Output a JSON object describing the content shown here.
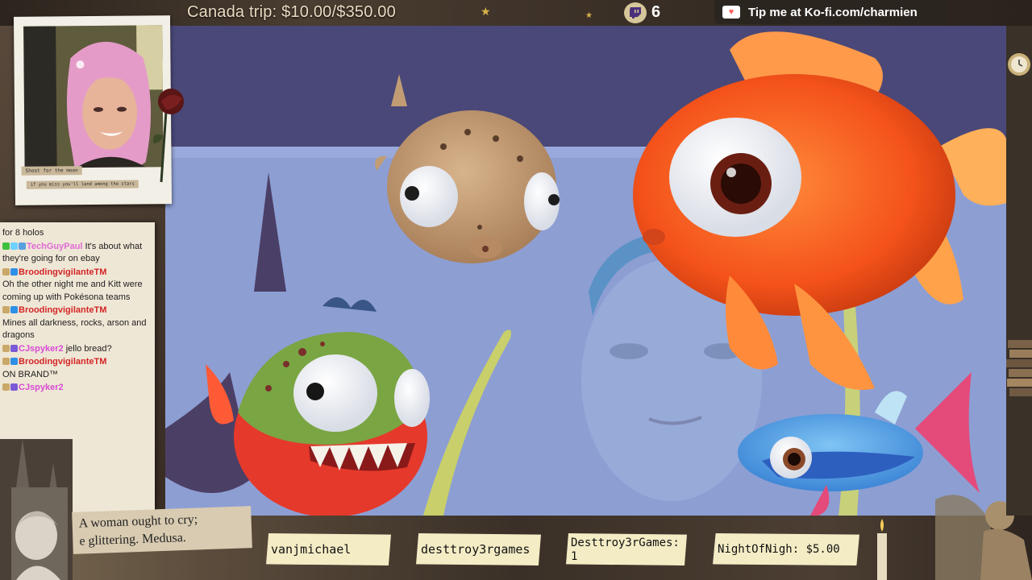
{
  "stream": {
    "goal_text": "Canada trip: $10.00/$350.00",
    "viewer_count": "6",
    "tip_text": "Tip me at Ko-fi.com/charmien"
  },
  "webcam": {
    "note_top": "Shoot for the moon",
    "note_bottom": "if you miss you'll land among the stars"
  },
  "chat": {
    "messages": [
      {
        "user": "",
        "text": "for 8 holos",
        "color": "#1e1e1e"
      },
      {
        "user": "TechGuyPaul",
        "text": " It's about what they're going for on ebay",
        "color": "#e06ad7"
      },
      {
        "user": "BroodingvigilanteTM",
        "text": "Oh the other night me and Kitt were coming up with Pokésona teams",
        "color": "#d42525"
      },
      {
        "user": "BroodingvigilanteTM",
        "text": "Mines all darkness, rocks, arson and dragons",
        "color": "#d42525"
      },
      {
        "user": "CJspyker2",
        "text": " jello bread?",
        "color": "#d94bd4"
      },
      {
        "user": "BroodingvigilanteTM",
        "text": "ON BRAND™",
        "color": "#d42525"
      },
      {
        "user": "CJspyker2",
        "text": "",
        "color": "#d94bd4"
      }
    ]
  },
  "collage": {
    "line1": "A woman ought to cry;",
    "line2": "e glittering. Medusa."
  },
  "labels": [
    {
      "text": "vanjmichael"
    },
    {
      "text": "desttroy3rgames"
    },
    {
      "text": "Desttroy3rGames: 1"
    },
    {
      "text": "NightOfNigh: $5.00"
    }
  ],
  "colors": {
    "chat_bg": "#efe7d6",
    "label_bg": "#f4ecc5",
    "kofi_bg": "#2b2520",
    "accent_gold": "#d9b44a"
  },
  "icons": [
    "twitch-icon",
    "kofi-heart-icon",
    "star-icon",
    "rose-icon",
    "candle-icon",
    "clock-icon"
  ]
}
